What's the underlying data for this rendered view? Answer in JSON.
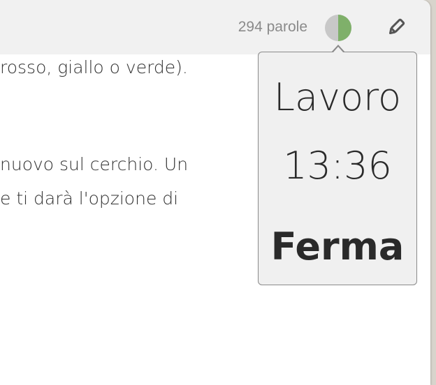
{
  "toolbar": {
    "word_count": "294 parole",
    "pomodoro_icon": "pie-progress-icon",
    "pomodoro_progress": 0.5,
    "edit_icon": "pencil-icon",
    "colors": {
      "toolbar_bg": "#f1f1f1",
      "pie_done": "#7fb06a",
      "pie_remaining": "#c8c8c8",
      "icon": "#555555"
    }
  },
  "document": {
    "lines": [
      "rosso, giallo o verde).",
      "nuovo sul cerchio. Un",
      "e ti darà l'opzione di"
    ]
  },
  "popover": {
    "phase": "Lavoro",
    "time": "13:36",
    "stop_label": "Ferma"
  }
}
